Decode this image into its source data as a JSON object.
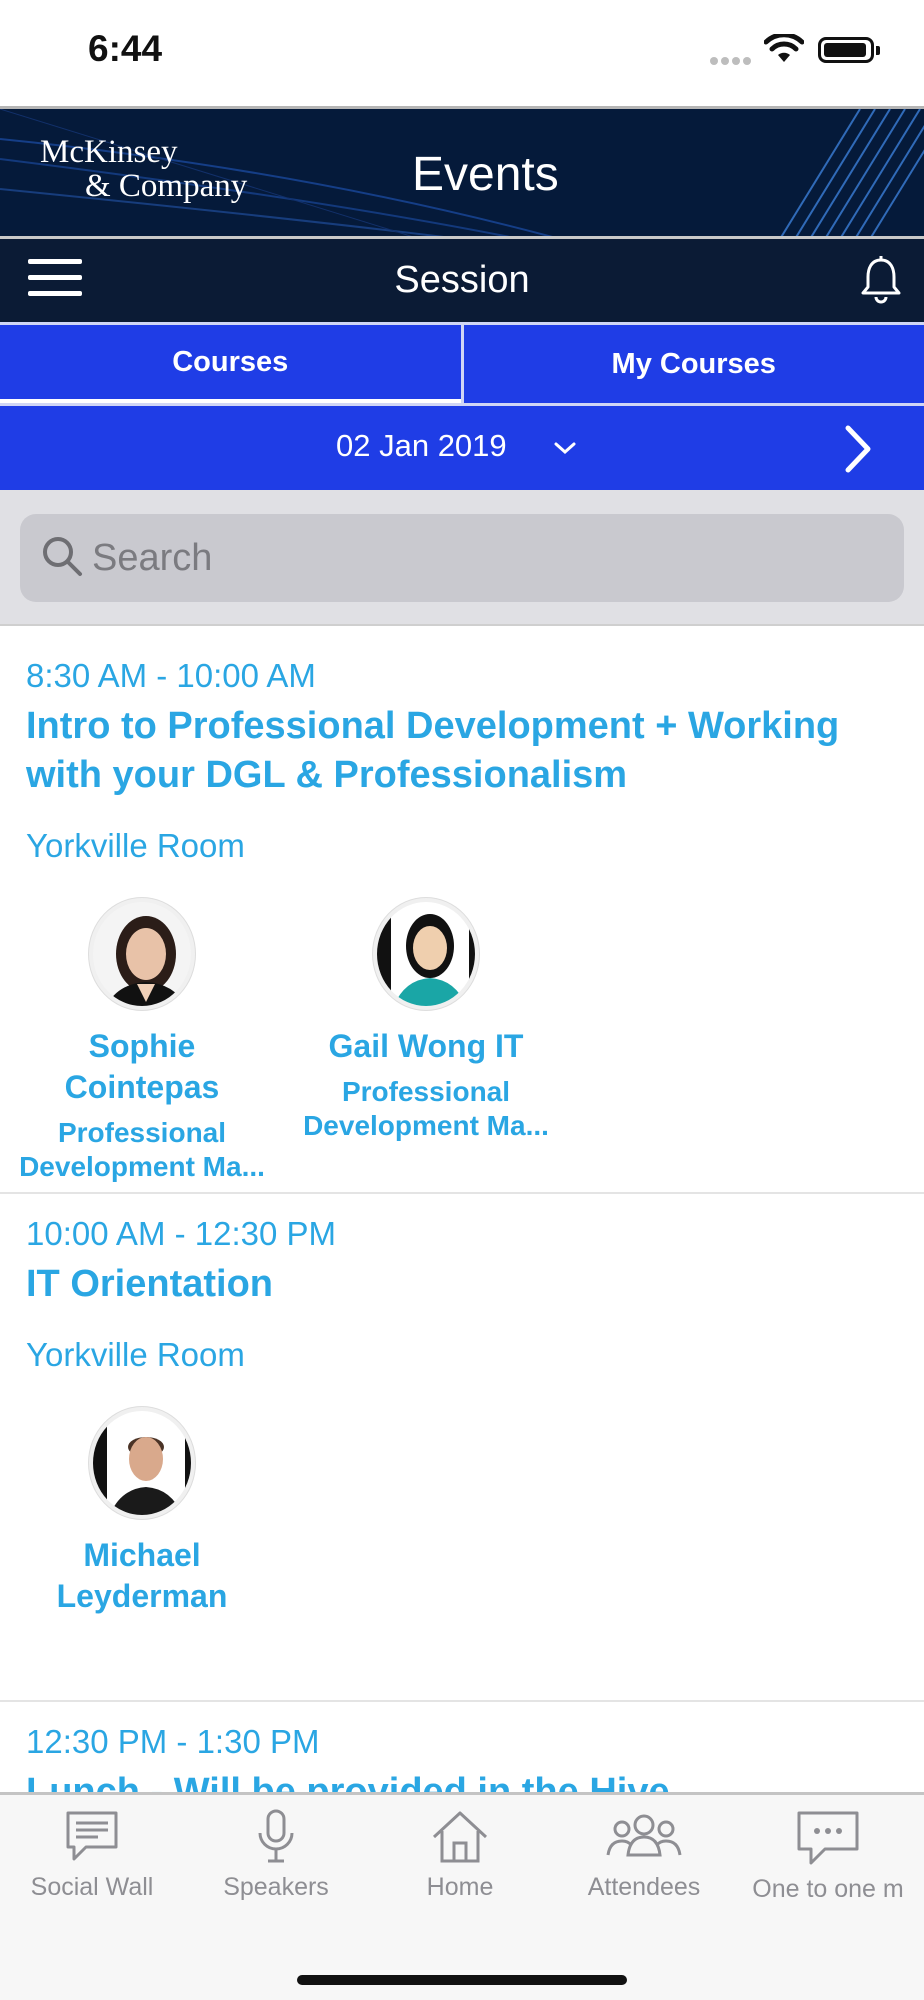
{
  "status_bar": {
    "time": "6:44"
  },
  "banner": {
    "brand_line1": "McKinsey",
    "brand_line2": "& Company",
    "title": "Events"
  },
  "navbar": {
    "title": "Session"
  },
  "tabs": [
    {
      "label": "Courses",
      "active": true
    },
    {
      "label": "My Courses",
      "active": false
    }
  ],
  "date_bar": {
    "date": "02 Jan 2019"
  },
  "search": {
    "placeholder": "Search",
    "value": ""
  },
  "sessions": [
    {
      "time": "8:30 AM - 10:00 AM",
      "title": "Intro to Professional Development + Working with your DGL & Professionalism",
      "room": "Yorkville Room",
      "speakers": [
        {
          "name": "Sophie Cointepas",
          "role": "Professional\nDevelopment Ma..."
        },
        {
          "name": "Gail Wong IT",
          "role": "Professional\nDevelopment Ma..."
        }
      ]
    },
    {
      "time": "10:00 AM - 12:30 PM",
      "title": "IT Orientation",
      "room": "Yorkville Room",
      "speakers": [
        {
          "name": "Michael Leyderman",
          "role": ""
        }
      ]
    },
    {
      "time": "12:30 PM - 1:30 PM",
      "title": "Lunch - Will be provided in the Hive",
      "room": "",
      "speakers": []
    }
  ],
  "tabbar": {
    "items": [
      {
        "label": "Social Wall",
        "icon": "chat-lines-icon"
      },
      {
        "label": "Speakers",
        "icon": "microphone-icon"
      },
      {
        "label": "Home",
        "icon": "home-icon"
      },
      {
        "label": "Attendees",
        "icon": "people-group-icon"
      },
      {
        "label": "One to one m",
        "icon": "chat-dots-icon"
      }
    ]
  },
  "colors": {
    "accent_blue": "#1f3de6",
    "navy": "#0b1b35",
    "session_text": "#2aa6e3",
    "tab_inactive": "#8e8e93"
  }
}
